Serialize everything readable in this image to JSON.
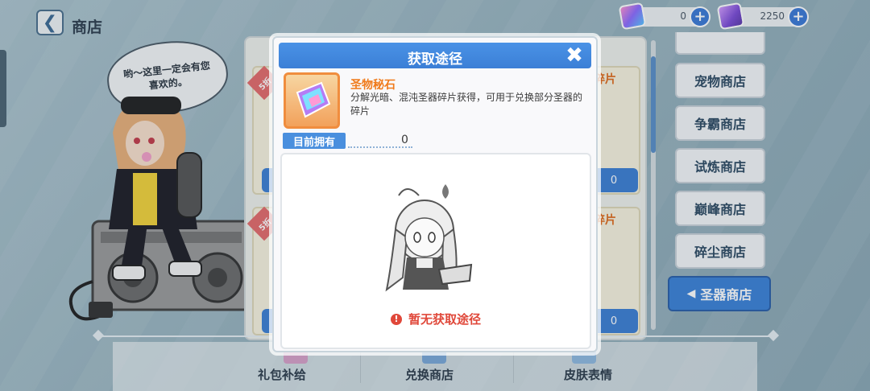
{
  "header": {
    "title": "商店"
  },
  "currency": [
    {
      "value": "0"
    },
    {
      "value": "2250"
    }
  ],
  "speech_bubble": "哟～这里一定会有您喜欢的。",
  "shop_cards": {
    "discount": "5折",
    "name_fragment": "碎片",
    "btn_fragment": "0"
  },
  "right_nav": {
    "items": [
      {
        "label": "宠物商店"
      },
      {
        "label": "争霸商店"
      },
      {
        "label": "试炼商店"
      },
      {
        "label": "巅峰商店"
      },
      {
        "label": "碎尘商店"
      },
      {
        "label": "圣器商店"
      }
    ]
  },
  "bottom_tabs": [
    {
      "label": "礼包补给"
    },
    {
      "label": "兑换商店"
    },
    {
      "label": "皮肤表情"
    }
  ],
  "modal": {
    "title": "获取途径",
    "item_name": "圣物秘石",
    "item_desc": "分解光暗、混沌圣器碎片获得，可用于兑换部分圣器的碎片",
    "owned_label": "目前拥有",
    "owned_value": "0",
    "empty_message": "暂无获取途径"
  }
}
